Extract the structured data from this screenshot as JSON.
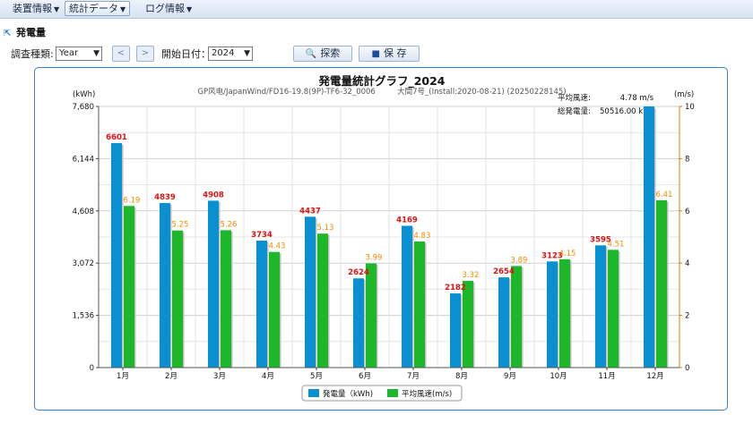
{
  "menu": {
    "items": [
      {
        "label": "装置情報"
      },
      {
        "label": "統計データ"
      },
      {
        "label": "ログ情報"
      }
    ]
  },
  "section": {
    "title": "発電量"
  },
  "filters": {
    "survey_label": "調査種類:",
    "survey_value": "Year",
    "start_label": "開始日付：",
    "start_value": "2024",
    "search_label": "探索",
    "save_label": "保 存"
  },
  "colors": {
    "power_bar": "#0a8fd0",
    "wind_bar": "#1cb82a",
    "power_label": "#e01010",
    "wind_label": "#f08c00",
    "panel_border": "#3c7fc4"
  },
  "chart_data": {
    "type": "bar",
    "title": "発電量統計グラフ_2024",
    "subtitle": "GP风电/JapanWind/FD16-19.8(9P)-TF6-32_0006         大間7号_(Install:2020-08-21) (20250228145)",
    "summary": {
      "avg_wind_label": "平均風速:",
      "avg_wind_value": "4.78 m/s",
      "total_power_label": "総発電量:",
      "total_power_value": "50516.00 kWh"
    },
    "categories": [
      "1月",
      "2月",
      "3月",
      "4月",
      "5月",
      "6月",
      "7月",
      "8月",
      "9月",
      "10月",
      "11月",
      "12月"
    ],
    "y_left": {
      "label": "(kWh)",
      "min": 0,
      "max": 7680,
      "ticks": [
        "0",
        "1,536",
        "3,072",
        "4,608",
        "6,144",
        "7,680"
      ]
    },
    "y_right": {
      "label": "(m/s)",
      "min": 0,
      "max": 10,
      "ticks": [
        "0",
        "2",
        "4",
        "6",
        "8",
        "10"
      ]
    },
    "series": [
      {
        "name": "発電量（kWh)",
        "axis": "left",
        "values": [
          6601,
          4839,
          4908,
          3734,
          4437,
          2624,
          4169,
          2182,
          2654,
          3123,
          3595,
          7680
        ],
        "labels": [
          "6601",
          "4839",
          "4908",
          "3734",
          "4437",
          "2624",
          "4169",
          "2182",
          "2654",
          "3123",
          "3595",
          ""
        ]
      },
      {
        "name": "平均風速(m/s)",
        "axis": "right",
        "values": [
          6.19,
          5.25,
          5.26,
          4.43,
          5.13,
          3.99,
          4.83,
          3.32,
          3.89,
          4.15,
          4.51,
          6.41
        ],
        "labels": [
          "6.19",
          "5.25",
          "5.26",
          "4.43",
          "5.13",
          "3.99",
          "4.83",
          "3.32",
          "3.89",
          "4.15",
          "4.51",
          "6.41"
        ]
      }
    ],
    "grid": true,
    "legend": "bottom"
  }
}
